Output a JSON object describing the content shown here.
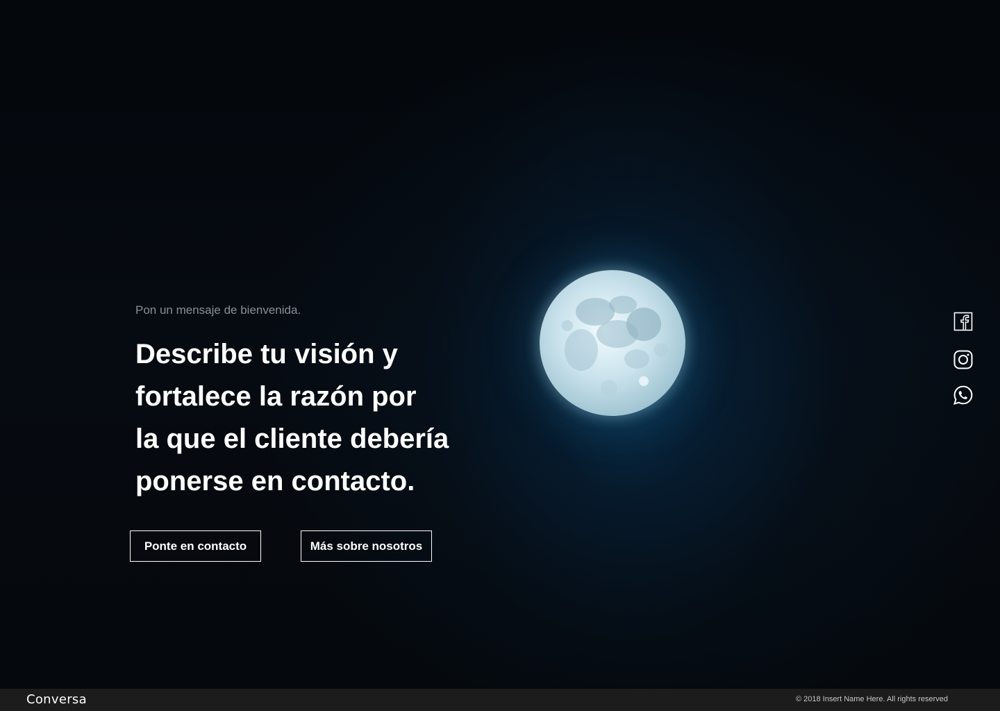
{
  "hero": {
    "welcome": "Pon un mensaje de bienvenida.",
    "headline_lines": [
      "Describe tu visión y",
      "fortalece la razón por",
      "la que el cliente debería",
      "ponerse en contacto."
    ],
    "buttons": {
      "contact_label": "Ponte en contacto",
      "about_label": "Más sobre nosotros"
    },
    "background_image": "full-moon-night-sky"
  },
  "social": [
    {
      "icon": "facebook-icon"
    },
    {
      "icon": "instagram-icon"
    },
    {
      "icon": "whatsapp-icon"
    }
  ],
  "footer": {
    "brand": "Conversa",
    "copyright": "© 2018 Insert Name Here. All rights reserved"
  },
  "colors": {
    "background": "#05080c",
    "footer_bg": "#1c1c1c",
    "text": "#ffffff",
    "muted": "#8a8f96",
    "glow": "#0a4a6e"
  }
}
